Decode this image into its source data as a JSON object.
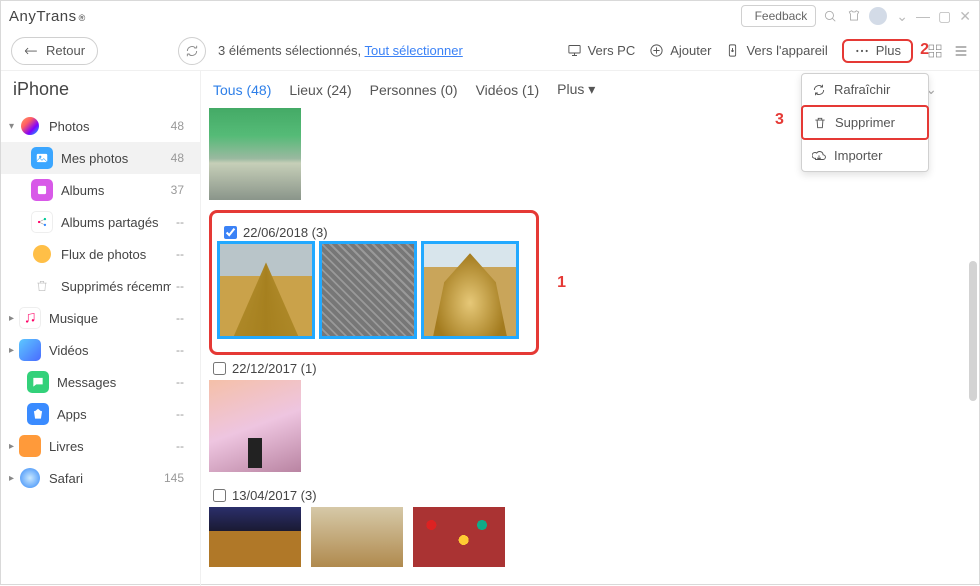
{
  "titlebar": {
    "app": "AnyTrans",
    "reg": "®",
    "feedback": "Feedback"
  },
  "toolbar": {
    "back": "Retour",
    "selection_prefix": "3 éléments sélectionnés, ",
    "select_all": "Tout sélectionner",
    "to_pc": "Vers PC",
    "add": "Ajouter",
    "to_device": "Vers l'appareil",
    "more": "Plus"
  },
  "dropdown": {
    "refresh": "Rafraîchir",
    "delete": "Supprimer",
    "import": "Importer"
  },
  "callouts": {
    "one": "1",
    "two": "2",
    "three": "3"
  },
  "sidebar": {
    "device": "iPhone",
    "photos": {
      "label": "Photos",
      "count": "48"
    },
    "myphotos": {
      "label": "Mes photos",
      "count": "48"
    },
    "albums": {
      "label": "Albums",
      "count": "37"
    },
    "shared": {
      "label": "Albums partagés",
      "count": "--"
    },
    "stream": {
      "label": "Flux de photos",
      "count": "--"
    },
    "deleted": {
      "label": "Supprimés récemment",
      "count": "--"
    },
    "music": {
      "label": "Musique",
      "count": "--"
    },
    "videos": {
      "label": "Vidéos",
      "count": "--"
    },
    "messages": {
      "label": "Messages",
      "count": "--"
    },
    "apps": {
      "label": "Apps",
      "count": "--"
    },
    "books": {
      "label": "Livres",
      "count": "--"
    },
    "safari": {
      "label": "Safari",
      "count": "145"
    }
  },
  "filters": {
    "all": "Tous (48)",
    "places": "Lieux (24)",
    "people": "Personnes (0)",
    "videos": "Vidéos (1)",
    "more": "Plus"
  },
  "groups": [
    {
      "date": "22/06/2018 (3)",
      "checked": true,
      "selected_box": true
    },
    {
      "date": "22/12/2017 (1)",
      "checked": false
    },
    {
      "date": "13/04/2017 (3)",
      "checked": false
    }
  ]
}
